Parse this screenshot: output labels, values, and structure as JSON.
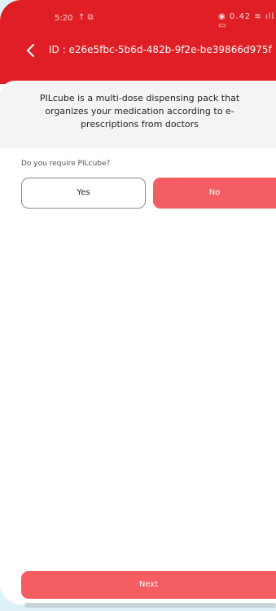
{
  "status_bar": {
    "time": "5:20",
    "left_icons": "↑ ⧉",
    "right_icons": "◉ 0.42 ≋ ıll ▭"
  },
  "header": {
    "back_icon": "chevron-left-icon",
    "order_id": "ID : e26e5fbc-5b6d-482b-9f2e-be39866d975f"
  },
  "info": {
    "text": "PILcube is a multi-dose dispensing pack that organizes your medication according to e-prescriptions from doctors"
  },
  "question": {
    "label": "Do you require PILcube?",
    "options": [
      "Yes",
      "No"
    ],
    "selected": "No"
  },
  "footer": {
    "next_label": "Next"
  },
  "colors": {
    "header": "#e01e25",
    "primary_button": "#f45e62",
    "background": "#dff1f8"
  }
}
